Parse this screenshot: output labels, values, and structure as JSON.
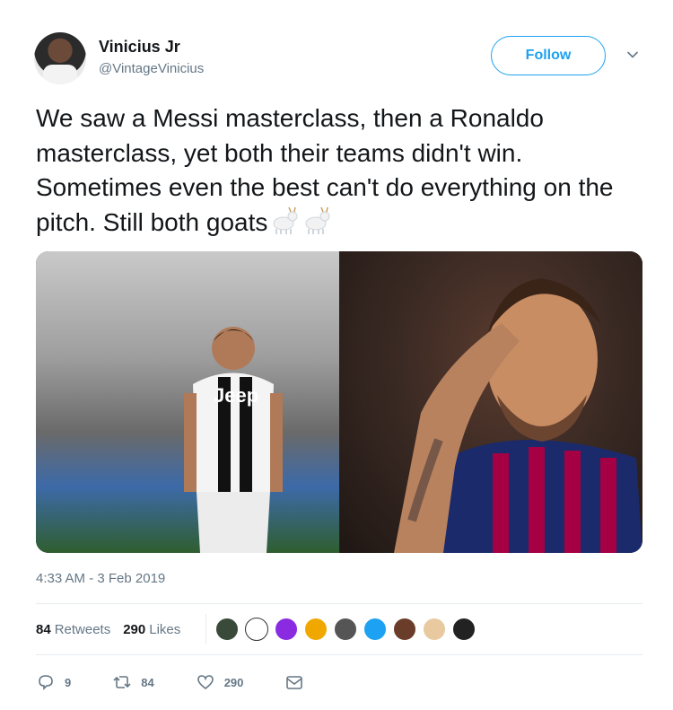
{
  "user": {
    "name": "Vinicius Jr",
    "handle": "@VintageVinicius",
    "follow_label": "Follow"
  },
  "tweet": {
    "text": "We saw a Messi masterclass, then a Ronaldo masterclass, yet both their teams didn't win. Sometimes even the best can't do everything on the pitch. Still both goats",
    "emoji": "🐐🐐",
    "timestamp": "4:33 AM - 3 Feb 2019",
    "media_labels": {
      "jersey_sponsor": "Jeep"
    }
  },
  "stats": {
    "retweets_count": "84",
    "retweets_label": "Retweets",
    "likes_count": "290",
    "likes_label": "Likes",
    "liker_colors": [
      "#3a4a3a",
      "#ffffff",
      "#8a2be2",
      "#f0a800",
      "#555555",
      "#1da1f2",
      "#6a3d2a",
      "#e8c9a0",
      "#222222"
    ]
  },
  "actions": {
    "reply_count": "9",
    "retweet_count": "84",
    "like_count": "290"
  },
  "colors": {
    "accent": "#1da1f2",
    "secondary_text": "#657786",
    "primary_text": "#14171a"
  }
}
